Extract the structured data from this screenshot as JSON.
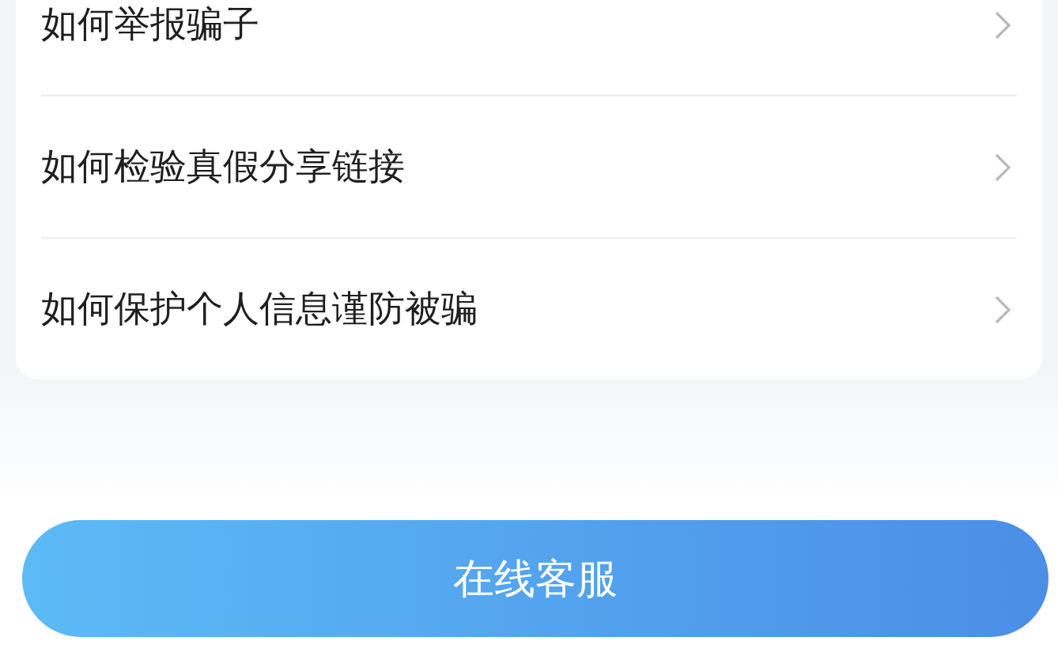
{
  "help_items": [
    {
      "label": "如何举报骗子"
    },
    {
      "label": "如何检验真假分享链接"
    },
    {
      "label": "如何保护个人信息谨防被骗"
    }
  ],
  "service_button": {
    "label": "在线客服"
  }
}
